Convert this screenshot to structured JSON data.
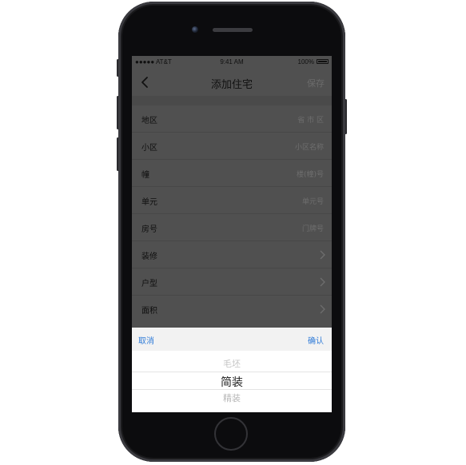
{
  "status_bar": {
    "carrier": "●●●●● AT&T",
    "time": "9:41 AM",
    "battery": "100%"
  },
  "nav": {
    "back_icon": "chevron-left-icon",
    "title": "添加住宅",
    "save": "保存"
  },
  "form": {
    "rows": [
      {
        "label": "地区",
        "value": "省 市 区"
      },
      {
        "label": "小区",
        "value": "小区名称"
      },
      {
        "label": "幢",
        "value": "楼(幢)号"
      },
      {
        "label": "单元",
        "value": "单元号"
      },
      {
        "label": "房号",
        "value": "门牌号"
      },
      {
        "label": "装修",
        "value": ""
      },
      {
        "label": "户型",
        "value": ""
      },
      {
        "label": "面积",
        "value": ""
      }
    ],
    "chevron_icon": "chevron-right-icon"
  },
  "picker": {
    "cancel": "取消",
    "confirm": "确认",
    "options": [
      "毛坯",
      "简装",
      "精装"
    ],
    "selected": "简装"
  },
  "colors": {
    "accent": "#2f7bd8",
    "overlay": "#505050"
  }
}
